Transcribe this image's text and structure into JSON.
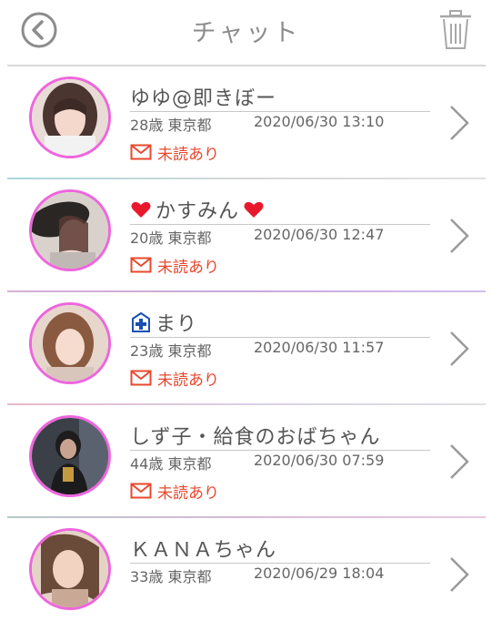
{
  "header": {
    "title": "チャット",
    "back_icon": "back-circle-icon",
    "trash_icon": "trash-icon"
  },
  "colors": {
    "avatar_border": "#ee66dd",
    "unread": "#e8492e",
    "heart": "#e8192c",
    "hospital": "#1a4fb5"
  },
  "chats": [
    {
      "name": "ゆゆ@即きぼー",
      "age_area": "28歳 東京都",
      "timestamp": "2020/06/30 13:10",
      "unread_label": "未読あり",
      "name_prefix_icon": "",
      "name_suffix_icon": ""
    },
    {
      "name": "かすみん",
      "age_area": "20歳 東京都",
      "timestamp": "2020/06/30 12:47",
      "unread_label": "未読あり",
      "name_prefix_icon": "heart-icon",
      "name_suffix_icon": "heart-icon"
    },
    {
      "name": "まり",
      "age_area": "23歳 東京都",
      "timestamp": "2020/06/30 11:57",
      "unread_label": "未読あり",
      "name_prefix_icon": "hospital-icon",
      "name_suffix_icon": ""
    },
    {
      "name": "しず子・給食のおばちゃん",
      "age_area": "44歳 東京都",
      "timestamp": "2020/06/30 07:59",
      "unread_label": "未読あり",
      "name_prefix_icon": "",
      "name_suffix_icon": ""
    },
    {
      "name": "ＫＡＮＡちゃん",
      "age_area": "33歳 東京都",
      "timestamp": "2020/06/29 18:04",
      "unread_label": "",
      "name_prefix_icon": "",
      "name_suffix_icon": ""
    }
  ]
}
